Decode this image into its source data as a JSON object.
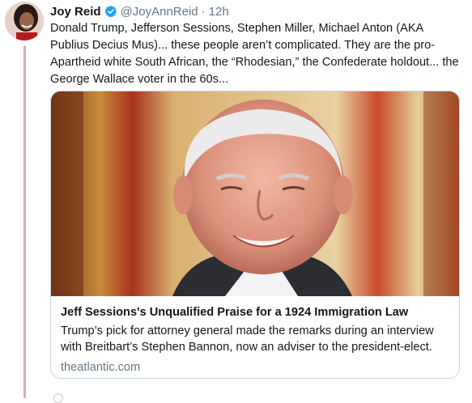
{
  "tweet": {
    "display_name": "Joy Reid",
    "handle": "@JoyAnnReid",
    "separator": "·",
    "timestamp": "12h",
    "text": "Donald Trump, Jefferson Sessions, Stephen Miller, Michael Anton (AKA Publius Decius Mus)... these people aren’t complicated. They are the pro-Apartheid white South African, the “Rhodesian,” the Confederate holdout... the George Wallace voter in the 60s..."
  },
  "card": {
    "title": "Jeff Sessions's Unqualified Praise for a 1924 Immigration Law",
    "description": "Trump’s pick for attorney general made the remarks during an interview with Breitbart’s Stephen Bannon, now an adviser to the president-elect.",
    "domain": "theatlantic.com"
  },
  "colors": {
    "verified_badge": "#1da1f2",
    "thread_line": "#e0a8b0",
    "secondary_text": "#657786",
    "card_border": "#ccd6dd"
  },
  "icons": {
    "verified": "verified-badge-icon"
  }
}
